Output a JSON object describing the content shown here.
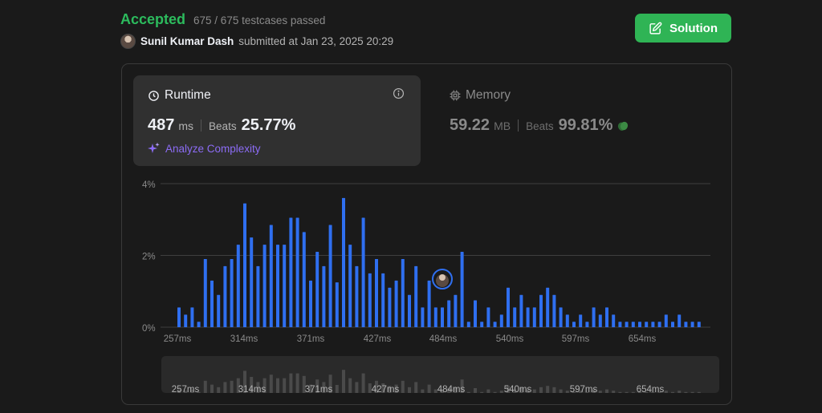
{
  "header": {
    "status": "Accepted",
    "testcases": "675 / 675 testcases passed",
    "author": "Sunil Kumar Dash",
    "submitted": "submitted at Jan 23, 2025 20:29"
  },
  "solution_button": {
    "label": "Solution",
    "icon": "edit-icon",
    "color": "#2fb455"
  },
  "runtime": {
    "title": "Runtime",
    "value": "487",
    "unit": "ms",
    "beats_label": "Beats",
    "beats": "25.77%",
    "analyze": "Analyze Complexity"
  },
  "memory": {
    "title": "Memory",
    "value": "59.22",
    "unit": "MB",
    "beats_label": "Beats",
    "beats": "99.81%"
  },
  "chart_data": {
    "type": "bar",
    "ylim": [
      0,
      4
    ],
    "y_ticks": [
      "0%",
      "2%",
      "4%"
    ],
    "x_ticks": [
      "257ms",
      "314ms",
      "371ms",
      "427ms",
      "484ms",
      "540ms",
      "597ms",
      "654ms"
    ],
    "bar_color": "#2f6ff0",
    "current_bar_index": 40,
    "values": [
      0.55,
      0.35,
      0.55,
      0.15,
      1.9,
      1.3,
      0.9,
      1.7,
      1.9,
      2.3,
      3.45,
      2.5,
      1.7,
      2.3,
      2.85,
      2.3,
      2.3,
      3.05,
      3.05,
      2.65,
      1.3,
      2.1,
      1.7,
      2.85,
      1.25,
      3.6,
      2.3,
      1.7,
      3.05,
      1.5,
      1.9,
      1.5,
      1.1,
      1.3,
      1.9,
      0.9,
      1.7,
      0.55,
      1.3,
      0.55,
      0.55,
      0.75,
      0.9,
      2.1,
      0.15,
      0.75,
      0.15,
      0.55,
      0.15,
      0.35,
      1.1,
      0.55,
      0.9,
      0.55,
      0.55,
      0.9,
      1.1,
      0.9,
      0.55,
      0.35,
      0.15,
      0.35,
      0.15,
      0.55,
      0.35,
      0.55,
      0.35,
      0.15,
      0.15,
      0.15,
      0.15,
      0.15,
      0.15,
      0.15,
      0.35,
      0.15,
      0.35,
      0.15,
      0.15,
      0.15
    ]
  }
}
